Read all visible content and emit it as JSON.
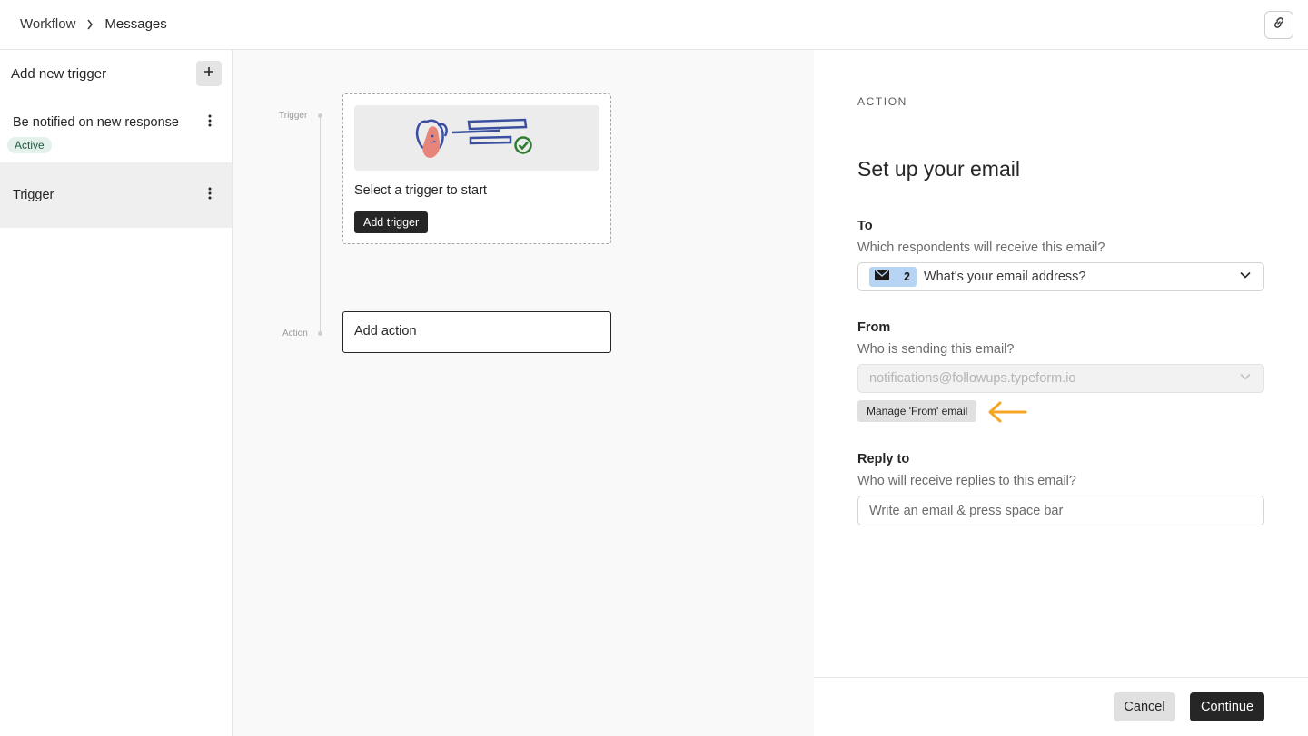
{
  "breadcrumb": {
    "parent": "Workflow",
    "current": "Messages"
  },
  "header": {
    "link_icon": "link-icon"
  },
  "sidebar": {
    "header": "Add new trigger",
    "add_icon": "plus-icon",
    "items": [
      {
        "label": "Be notified on new response",
        "badge": "Active"
      },
      {
        "label": "Trigger"
      }
    ]
  },
  "canvas": {
    "trigger_label": "Trigger",
    "action_label": "Action",
    "trigger_card": {
      "text": "Select a trigger to start",
      "button": "Add trigger"
    },
    "action_card": {
      "text": "Add action"
    }
  },
  "panel": {
    "eyebrow": "ACTION",
    "title": "Set up your email",
    "to": {
      "label": "To",
      "help": "Which respondents will receive this email?",
      "chip_icon": "envelope-icon",
      "chip_number": "2",
      "value": "What's your email address?"
    },
    "from": {
      "label": "From",
      "help": "Who is sending this email?",
      "value": "notifications@followups.typeform.io",
      "manage_button": "Manage 'From' email"
    },
    "reply_to": {
      "label": "Reply to",
      "help": "Who will receive replies to this email?",
      "placeholder": "Write an email & press space bar"
    },
    "footer": {
      "cancel": "Cancel",
      "continue": "Continue"
    }
  },
  "colors": {
    "accent_dark": "#262626",
    "active_badge_bg": "#e3f1ea",
    "chip_bg": "#b8d4f5",
    "arrow_hint": "#f5a623"
  }
}
